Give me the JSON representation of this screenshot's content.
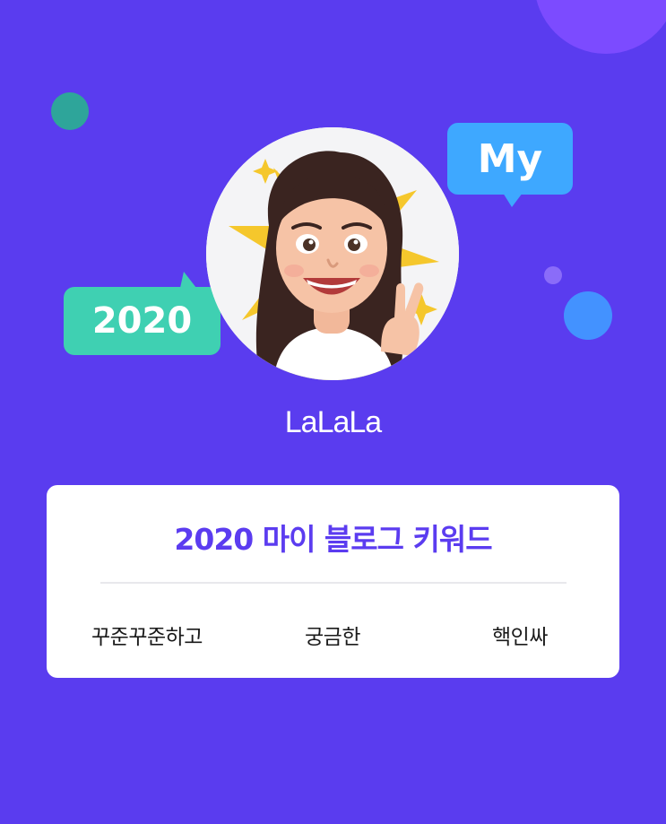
{
  "profile": {
    "name": "LaLaLa"
  },
  "bubbles": {
    "my": "My",
    "year": "2020"
  },
  "keywords_card": {
    "title": "2020 마이 블로그 키워드",
    "keywords": [
      "꾸준꾸준하고",
      "궁금한",
      "핵인싸"
    ]
  },
  "icons": {
    "avatar": "profile-avatar-memoji"
  },
  "colors": {
    "background": "#5a3cef",
    "accent": "#5b3cf0",
    "bubble_my": "#3ea8ff",
    "bubble_year": "#3fd0b2",
    "card": "#ffffff"
  }
}
